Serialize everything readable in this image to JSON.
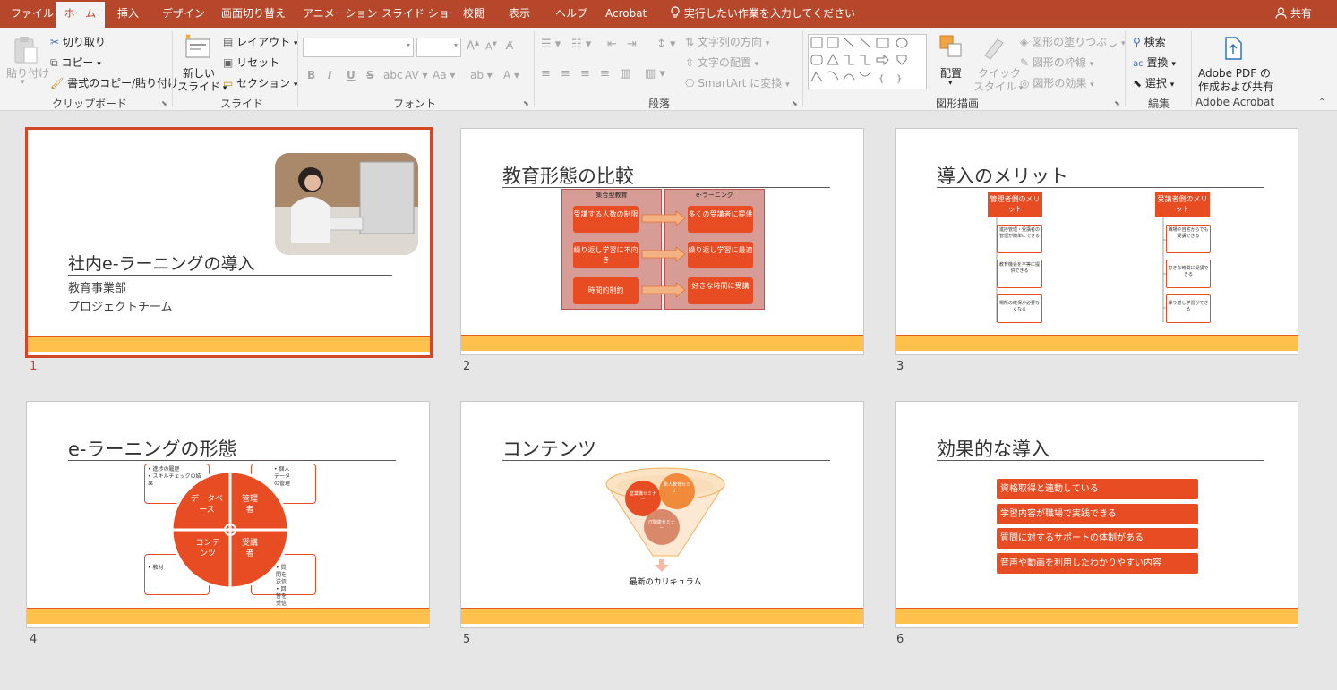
{
  "tabs": [
    "ファイル",
    "ホーム",
    "挿入",
    "デザイン",
    "画面切り替え",
    "アニメーション",
    "スライド ショー",
    "校閲",
    "表示",
    "ヘルプ",
    "Acrobat"
  ],
  "tell_me": "実行したい作業を入力してください",
  "share": "共有",
  "ribbon": {
    "clipboard": {
      "paste": "貼り付け",
      "cut": "切り取り",
      "copy": "コピー",
      "format_painter": "書式のコピー/貼り付け",
      "label": "クリップボード"
    },
    "slides": {
      "new_slide_1": "新しい",
      "new_slide_2": "スライド",
      "layout": "レイアウト",
      "reset": "リセット",
      "section": "セクション",
      "label": "スライド"
    },
    "font": {
      "label": "フォント",
      "bold": "B",
      "italic": "I",
      "underline": "U",
      "strike": "S",
      "shadow": "abc",
      "aa": "Aa",
      "grow": "A",
      "shrink": "A"
    },
    "paragraph": {
      "label": "段落",
      "text_dir": "文字列の方向",
      "align_text": "文字の配置",
      "smartart": "SmartArt に変換"
    },
    "drawing": {
      "arrange": "配置",
      "quick_1": "クイック",
      "quick_2": "スタイル",
      "fill": "図形の塗りつぶし",
      "outline": "図形の枠線",
      "effects": "図形の効果",
      "label": "図形描画"
    },
    "editing": {
      "find": "検索",
      "replace": "置換",
      "select": "選択",
      "label": "編集"
    },
    "acrobat": {
      "btn1": "Adobe PDF の",
      "btn2": "作成および共有",
      "label": "Adobe Acrobat"
    }
  },
  "slides": [
    {
      "num": "1",
      "title": "社内e-ラーニングの導入",
      "sub1": "教育事業部",
      "sub2": "プロジェクトチーム"
    },
    {
      "num": "2",
      "title": "教育形態の比較",
      "col_left": "集合型教育",
      "col_right": "e-ラーニング",
      "left": [
        "受講する人数の制限",
        "繰り返し学習に不向き",
        "時間的制約"
      ],
      "right": [
        "多くの受講者に提供",
        "繰り返し学習に最適",
        "好きな時間に受講"
      ]
    },
    {
      "num": "3",
      "title": "導入のメリット",
      "head_left": "管理者側のメリット",
      "head_right": "受講者側のメリット",
      "left": [
        "進捗管理・受講者の管理が簡単にできる",
        "教育機会を平等に提供できる",
        "場所の確保が必要なくなる"
      ],
      "right": [
        "職場や自宅からでも受講できる",
        "好きな時間に受講できる",
        "繰り返し学習ができる"
      ]
    },
    {
      "num": "4",
      "title": "e-ラーニングの形態",
      "quad": [
        "データベース",
        "管理者",
        "コンテンツ",
        "受講者"
      ],
      "notes": [
        "• 進捗の履歴\n• スキルチェックの結果",
        "• 個人データの管理",
        "• 教材",
        "• 質問を送信\n• 回答を受信"
      ]
    },
    {
      "num": "5",
      "title": "コンテンツ",
      "circles": [
        "営業職セミナー",
        "新人教育セミナー",
        "IT関連セミナー"
      ],
      "result": "最新のカリキュラム"
    },
    {
      "num": "6",
      "title": "効果的な導入",
      "items": [
        "資格取得と連動している",
        "学習内容が職場で実践できる",
        "質問に対するサポートの体制がある",
        "音声や動画を利用したわかりやすい内容"
      ]
    }
  ]
}
